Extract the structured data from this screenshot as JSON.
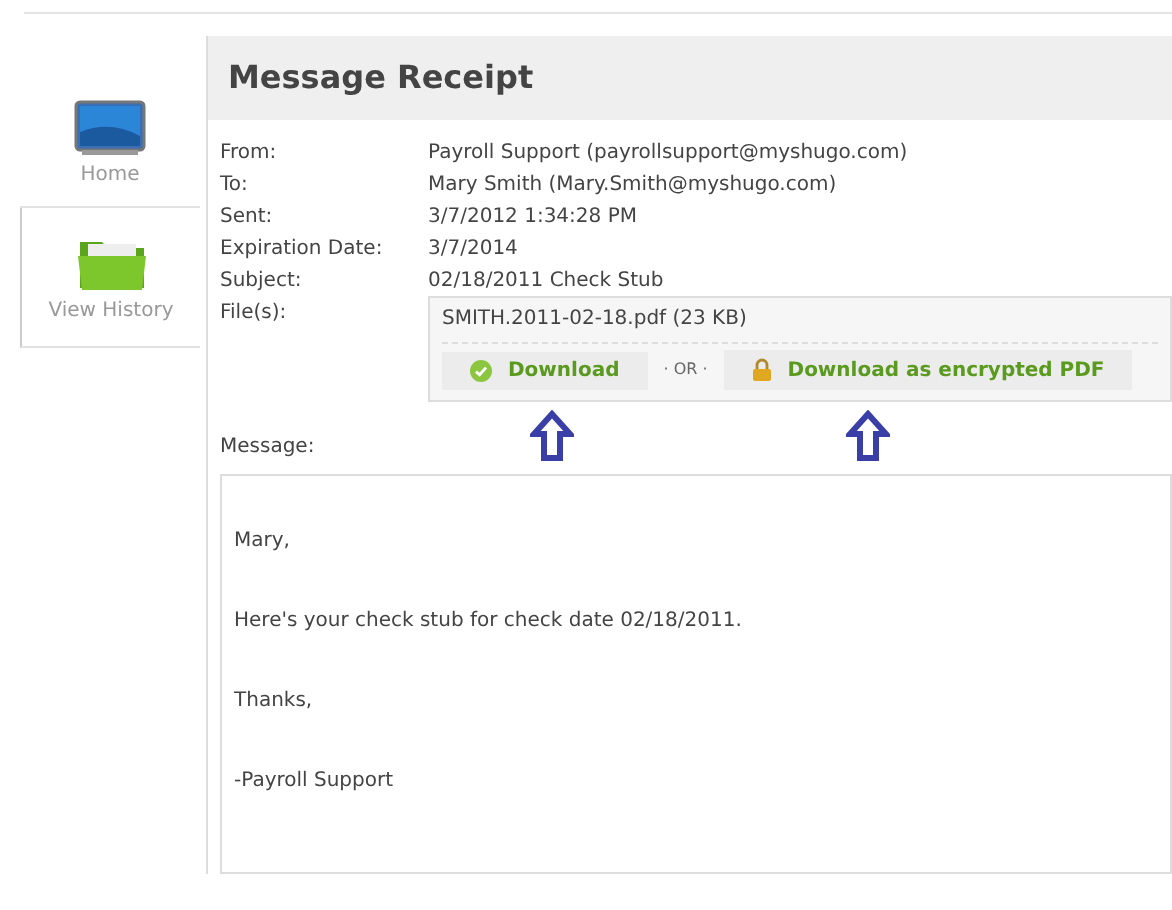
{
  "sidebar": {
    "items": [
      {
        "label": "Home",
        "kind": "monitor"
      },
      {
        "label": "View History",
        "kind": "folder"
      }
    ]
  },
  "receipt": {
    "title": "Message Receipt",
    "fields": [
      {
        "label": "From:",
        "value": "Payroll Support (payrollsupport@myshugo.com)"
      },
      {
        "label": "To:",
        "value": "Mary Smith (Mary.Smith@myshugo.com)"
      },
      {
        "label": "Sent:",
        "value": "3/7/2012 1:34:28 PM"
      },
      {
        "label": "Expiration Date:",
        "value": "3/7/2014"
      },
      {
        "label": "Subject:",
        "value": "02/18/2011 Check Stub"
      }
    ],
    "files_label": "File(s):",
    "file": {
      "name": "SMITH.2011-02-18.pdf (23 KB)",
      "download": "Download",
      "separator": "· OR ·",
      "download_encrypted": "Download as encrypted PDF"
    },
    "message_label": "Message:",
    "message_lines": [
      "Mary,",
      "Here's your check stub for check date 02/18/2011.",
      "Thanks,",
      "-Payroll Support"
    ]
  }
}
